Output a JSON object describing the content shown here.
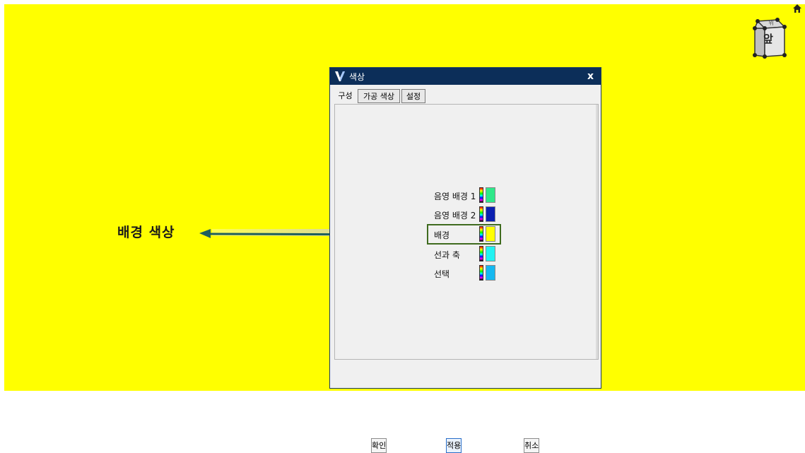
{
  "viewport": {
    "background_color": "#ffff00",
    "home_icon": "home-icon",
    "view_cube": {
      "top_label": "위",
      "front_label": "앞"
    }
  },
  "annotation": {
    "label": "배경 색상",
    "arrow_color": "#1f5f5f"
  },
  "dialog": {
    "title": "색상",
    "logo": "V",
    "close_label": "x",
    "tabs": [
      {
        "label": "구성",
        "active": true
      },
      {
        "label": "가공 색상",
        "active": false
      },
      {
        "label": "설정",
        "active": false
      }
    ],
    "color_items": [
      {
        "label": "음영 배경 1",
        "color": "#2ee88a",
        "highlighted": false
      },
      {
        "label": "음영 배경 2",
        "color": "#0b1fb0",
        "highlighted": false
      },
      {
        "label": "배경",
        "color": "#ffff00",
        "highlighted": true
      },
      {
        "label": "선과 축",
        "color": "#22f2f2",
        "highlighted": false
      },
      {
        "label": "선택",
        "color": "#15b8f0",
        "highlighted": false
      }
    ],
    "buttons": {
      "ok": "확인",
      "apply": "적용",
      "cancel": "취소"
    }
  }
}
